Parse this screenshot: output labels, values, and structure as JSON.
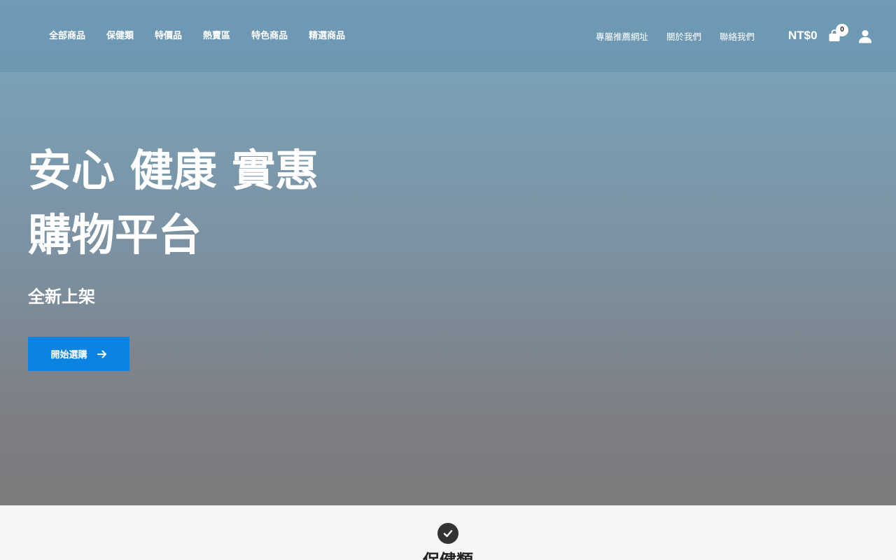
{
  "header": {
    "nav_left": [
      "全部商品",
      "保健類",
      "特價品",
      "熱賣區",
      "特色商品",
      "精選商品"
    ],
    "nav_right": [
      "專屬推薦網址",
      "關於我們",
      "聯絡我們"
    ],
    "cart_total": "NT$0",
    "cart_count": "0",
    "icons": {
      "cart": "shopping-bag-icon",
      "account": "user-icon"
    }
  },
  "hero": {
    "title_line1": "安心 健康 實惠",
    "title_line2": "購物平台",
    "subtitle": "全新上架",
    "cta_label": "開始選購",
    "cta_icon": "arrow-right-icon"
  },
  "section": {
    "icon": "check-circle-icon",
    "title": "保健類"
  },
  "colors": {
    "header_bg": "#6f9bb7",
    "cta_bg": "#0a84e0",
    "section_bg": "#f4f6f8",
    "section_icon_bg": "#333333"
  }
}
